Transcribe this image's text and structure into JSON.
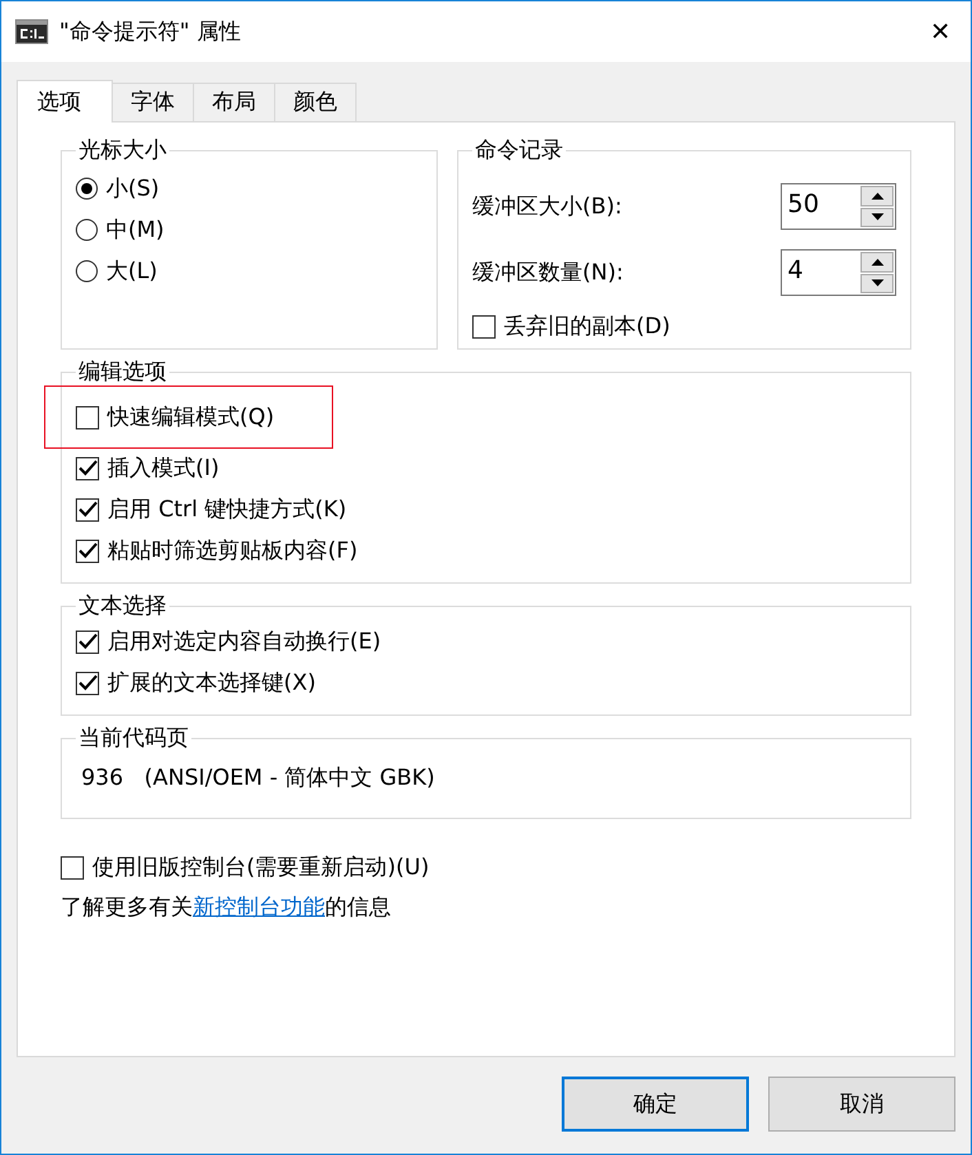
{
  "window": {
    "title": "\"命令提示符\" 属性",
    "close": "✕"
  },
  "tabs": [
    {
      "label": "选项",
      "selected": true
    },
    {
      "label": "字体",
      "selected": false
    },
    {
      "label": "布局",
      "selected": false
    },
    {
      "label": "颜色",
      "selected": false
    }
  ],
  "cursor_size": {
    "title": "光标大小",
    "options": [
      {
        "label": "小(S)",
        "selected": true
      },
      {
        "label": "中(M)",
        "selected": false
      },
      {
        "label": "大(L)",
        "selected": false
      }
    ]
  },
  "command_history": {
    "title": "命令记录",
    "spinners": [
      {
        "label": "缓冲区大小(B):",
        "value": "50"
      },
      {
        "label": "缓冲区数量(N):",
        "value": "4"
      }
    ],
    "discard": {
      "label": "丢弃旧的副本(D)",
      "checked": false
    }
  },
  "edit_options": {
    "title": "编辑选项",
    "items": [
      {
        "label": "快速编辑模式(Q)",
        "checked": false,
        "highlighted": true
      },
      {
        "label": "插入模式(I)",
        "checked": true,
        "highlighted": false
      },
      {
        "label": "启用 Ctrl 键快捷方式(K)",
        "checked": true,
        "highlighted": false
      },
      {
        "label": "粘贴时筛选剪贴板内容(F)",
        "checked": true,
        "highlighted": false
      }
    ]
  },
  "text_selection": {
    "title": "文本选择",
    "items": [
      {
        "label": "启用对选定内容自动换行(E)",
        "checked": true
      },
      {
        "label": "扩展的文本选择键(X)",
        "checked": true
      }
    ]
  },
  "code_page": {
    "title": "当前代码页",
    "value": "936   (ANSI/OEM - 简体中文 GBK)"
  },
  "legacy": {
    "label": "使用旧版控制台(需要重新启动)(U)",
    "checked": false
  },
  "info": {
    "before": "了解更多有关",
    "link": "新控制台功能",
    "after": "的信息"
  },
  "buttons": [
    {
      "label": "确定",
      "default": true
    },
    {
      "label": "取消",
      "default": false
    }
  ]
}
